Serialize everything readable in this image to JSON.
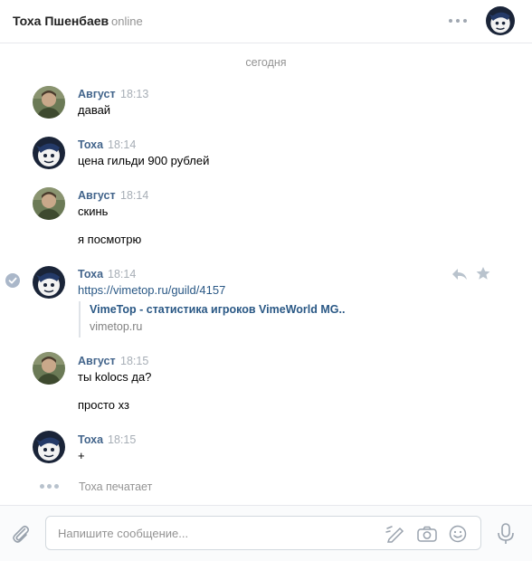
{
  "header": {
    "name": "Тоха Пшенбаев",
    "status": "online"
  },
  "date_separator": "сегодня",
  "messages": [
    {
      "author": "Август",
      "time": "18:13",
      "lines": [
        "давай"
      ]
    },
    {
      "author": "Тоха",
      "time": "18:14",
      "lines": [
        "цена гильди 900 рублей"
      ]
    },
    {
      "author": "Август",
      "time": "18:14",
      "lines": [
        "скинь",
        "я посмотрю"
      ]
    },
    {
      "author": "Тоха",
      "time": "18:14",
      "link": "https://vimetop.ru/guild/4157",
      "attachment": {
        "title": "VimeTop - статистика игроков VimeWorld MG..",
        "domain": "vimetop.ru"
      }
    },
    {
      "author": "Август",
      "time": "18:15",
      "lines": [
        "ты kolocs да?",
        "просто хз"
      ]
    },
    {
      "author": "Тоха",
      "time": "18:15",
      "lines": [
        "+"
      ]
    }
  ],
  "typing": "Тоха печатает",
  "composer": {
    "placeholder": "Напишите сообщение..."
  },
  "icons": {
    "more": "more-dots-icon",
    "read_status": "check-icon",
    "reply": "reply-icon",
    "favorite": "star-icon",
    "attach": "paperclip-icon",
    "graffiti": "graffiti-icon",
    "camera": "camera-icon",
    "emoji": "smile-icon",
    "voice": "microphone-icon"
  },
  "colors": {
    "author": "#42648b",
    "link": "#2a5885",
    "muted": "#939393"
  }
}
